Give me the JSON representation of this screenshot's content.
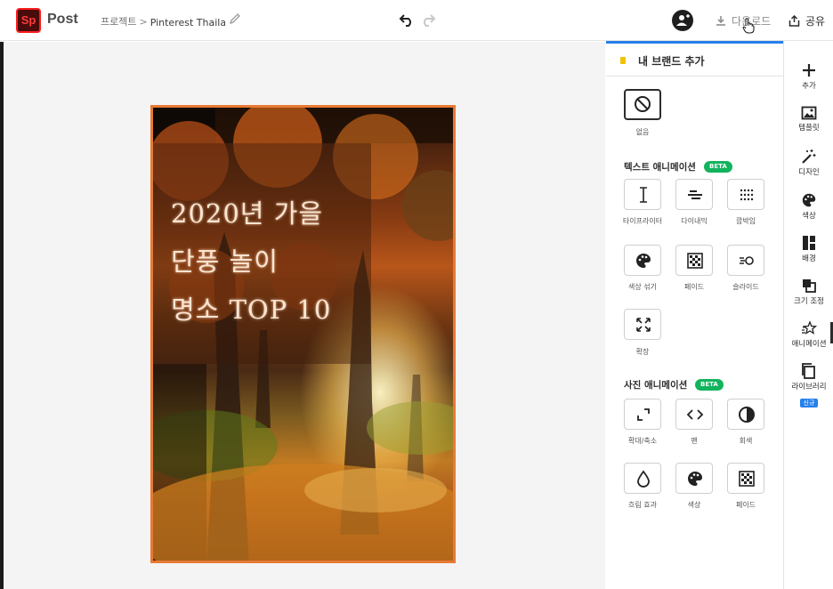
{
  "header": {
    "logo_text": "Sp",
    "app_name": "Post",
    "breadcrumb_root": "프로젝트",
    "breadcrumb_sep": ">",
    "project_name": "Pinterest Thailand t",
    "download_label": "다운로드",
    "share_label": "공유"
  },
  "poster": {
    "title_lines": [
      "2020년 가을",
      "단풍 놀이",
      "명소 TOP 10"
    ],
    "border_color": "#e87a35"
  },
  "panel": {
    "header_title": "내 브랜드 추가",
    "none_label": "없음",
    "text_section": {
      "title": "텍스트 애니메이션",
      "badge": "BETA",
      "items": [
        {
          "label": "타이프라이터",
          "icon": "text-cursor-icon"
        },
        {
          "label": "다이내믹",
          "icon": "align-center-icon"
        },
        {
          "label": "깜박임",
          "icon": "dots-grid-icon"
        },
        {
          "label": "색상 섞기",
          "icon": "palette-icon"
        },
        {
          "label": "페이드",
          "icon": "checker-icon"
        },
        {
          "label": "슬라이드",
          "icon": "slide-icon"
        },
        {
          "label": "확장",
          "icon": "expand-icon"
        }
      ]
    },
    "photo_section": {
      "title": "사진 애니메이션",
      "badge": "BETA",
      "items": [
        {
          "label": "확대/축소",
          "icon": "zoom-icon"
        },
        {
          "label": "팬",
          "icon": "pan-icon"
        },
        {
          "label": "회색",
          "icon": "grayscale-icon"
        },
        {
          "label": "흐림 효과",
          "icon": "drop-icon"
        },
        {
          "label": "색상",
          "icon": "palette-icon"
        },
        {
          "label": "페이드",
          "icon": "checker-icon"
        }
      ]
    }
  },
  "rail": {
    "items": [
      {
        "label": "추가",
        "icon": "plus-icon"
      },
      {
        "label": "템플릿",
        "icon": "template-icon"
      },
      {
        "label": "디자인",
        "icon": "magic-wand-icon"
      },
      {
        "label": "색상",
        "icon": "palette-icon"
      },
      {
        "label": "배경",
        "icon": "background-icon"
      },
      {
        "label": "크기 조정",
        "icon": "resize-icon"
      },
      {
        "label": "애니메이션",
        "icon": "animation-icon"
      },
      {
        "label": "라이브러리",
        "icon": "library-icon",
        "badge": "신규"
      }
    ],
    "active_item": "애니메이션"
  },
  "colors": {
    "accent": "#2680eb",
    "beta": "#12b35d",
    "brand": "#ff1d1d"
  }
}
